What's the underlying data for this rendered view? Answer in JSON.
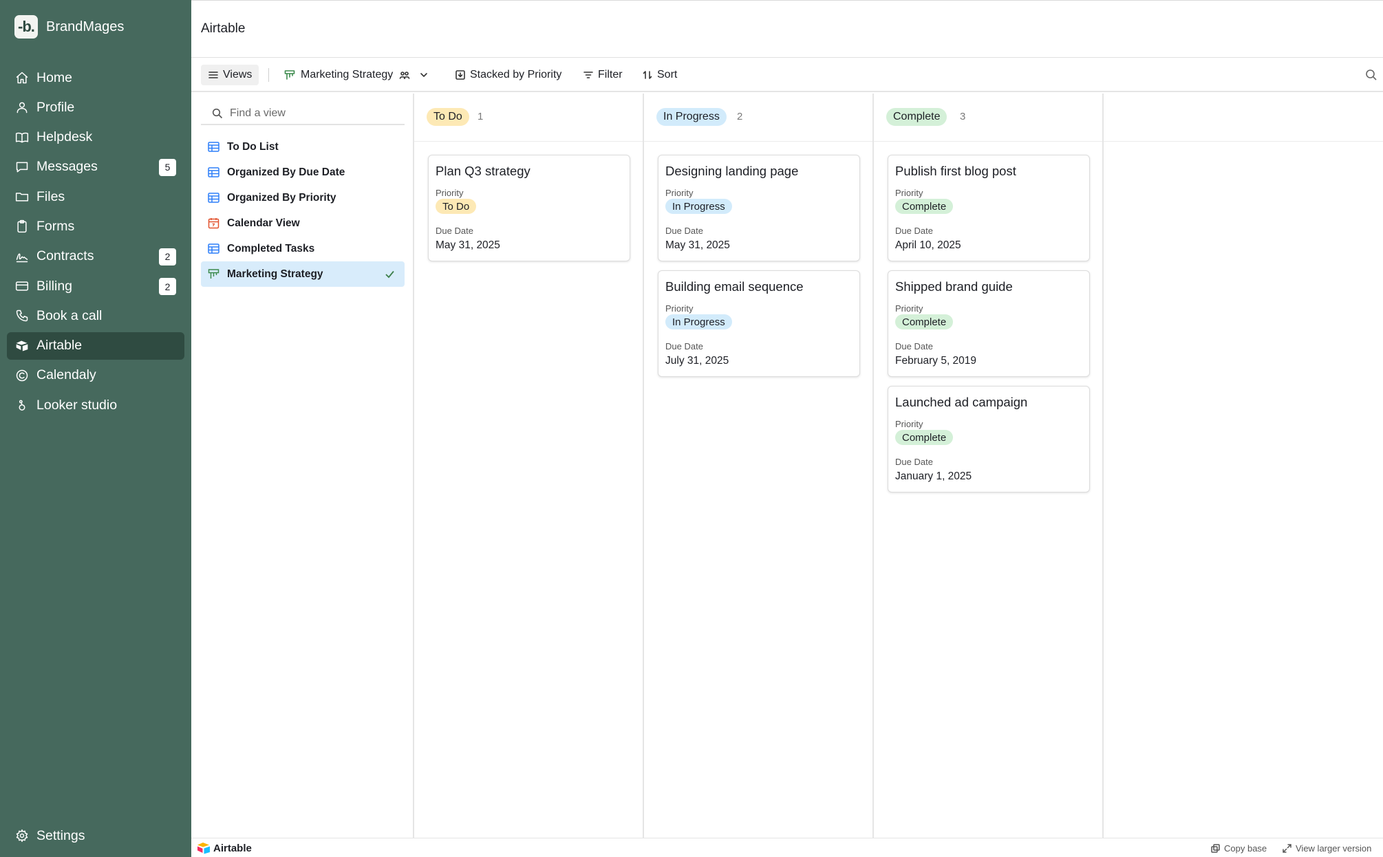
{
  "brand": {
    "logo_text": "-b.",
    "name": "BrandMages"
  },
  "nav": {
    "items": [
      {
        "label": "Home",
        "icon": "home-icon"
      },
      {
        "label": "Profile",
        "icon": "user-icon"
      },
      {
        "label": "Helpdesk",
        "icon": "book-icon"
      },
      {
        "label": "Messages",
        "icon": "message-icon",
        "badge": "5"
      },
      {
        "label": "Files",
        "icon": "folder-icon"
      },
      {
        "label": "Forms",
        "icon": "clipboard-icon"
      },
      {
        "label": "Contracts",
        "icon": "signature-icon",
        "badge": "2"
      },
      {
        "label": "Billing",
        "icon": "credit-card-icon",
        "badge": "2"
      },
      {
        "label": "Book a call",
        "icon": "phone-icon"
      },
      {
        "label": "Airtable",
        "icon": "airtable-icon",
        "active": true
      },
      {
        "label": "Calendaly",
        "icon": "calendly-icon"
      },
      {
        "label": "Looker studio",
        "icon": "looker-icon"
      }
    ],
    "settings_label": "Settings"
  },
  "main": {
    "title": "Airtable"
  },
  "toolbar": {
    "views_label": "Views",
    "current_view": "Marketing Strategy",
    "stack_label": "Stacked by Priority",
    "filter_label": "Filter",
    "sort_label": "Sort"
  },
  "views_panel": {
    "search_placeholder": "Find a view",
    "items": [
      {
        "label": "To Do List",
        "type": "grid"
      },
      {
        "label": "Organized By Due Date",
        "type": "grid"
      },
      {
        "label": "Organized By Priority",
        "type": "grid"
      },
      {
        "label": "Calendar View",
        "type": "calendar"
      },
      {
        "label": "Completed Tasks",
        "type": "grid"
      },
      {
        "label": "Marketing Strategy",
        "type": "kanban",
        "selected": true
      }
    ]
  },
  "board": {
    "columns": [
      {
        "name": "To Do",
        "count": "1",
        "color": "#fde9b5",
        "cards": [
          {
            "title": "Plan Q3 strategy",
            "priority_label": "Priority",
            "priority": "To Do",
            "due_label": "Due Date",
            "due": "May 31, 2025"
          }
        ]
      },
      {
        "name": "In Progress",
        "count": "2",
        "color": "#d2ebfb",
        "cards": [
          {
            "title": "Designing landing page",
            "priority_label": "Priority",
            "priority": "In Progress",
            "due_label": "Due Date",
            "due": "May 31, 2025"
          },
          {
            "title": "Building email sequence",
            "priority_label": "Priority",
            "priority": "In Progress",
            "due_label": "Due Date",
            "due": "July 31, 2025"
          }
        ]
      },
      {
        "name": "Complete",
        "count": "3",
        "color": "#d4f0d8",
        "cards": [
          {
            "title": "Publish first blog post",
            "priority_label": "Priority",
            "priority": "Complete",
            "due_label": "Due Date",
            "due": "April 10, 2025"
          },
          {
            "title": "Shipped brand guide",
            "priority_label": "Priority",
            "priority": "Complete",
            "due_label": "Due Date",
            "due": "February 5, 2019"
          },
          {
            "title": "Launched ad campaign",
            "priority_label": "Priority",
            "priority": "Complete",
            "due_label": "Due Date",
            "due": "January 1, 2025"
          }
        ]
      }
    ]
  },
  "footer": {
    "logo_text": "Airtable",
    "copy_base_label": "Copy base",
    "view_larger_label": "View larger version"
  }
}
